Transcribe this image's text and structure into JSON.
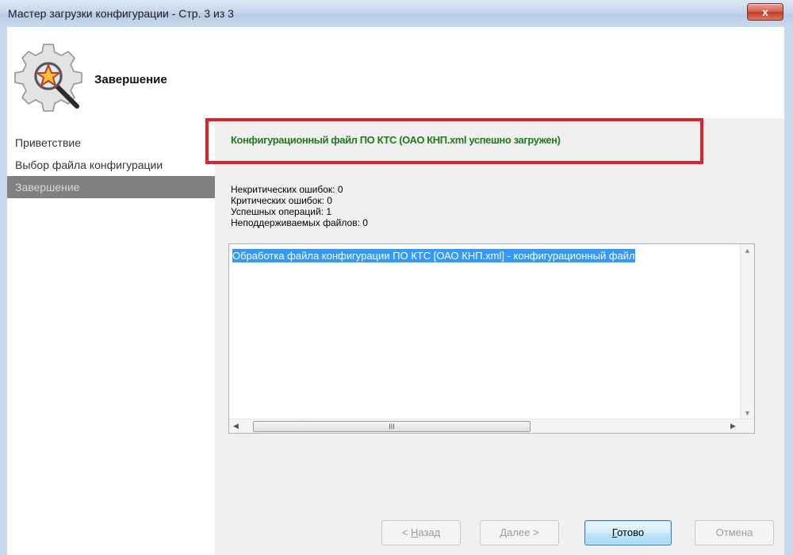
{
  "window": {
    "title": "Мастер загрузки конфигурации - Стр. 3 из 3",
    "close_label": "x"
  },
  "header": {
    "title": "Завершение",
    "logo_icon": "wizard-gear-icon"
  },
  "nav": {
    "items": [
      {
        "label": "Приветствие",
        "active": false
      },
      {
        "label": "Выбор файла конфигурации",
        "active": false
      },
      {
        "label": "Завершение",
        "active": true
      }
    ]
  },
  "result": {
    "message": "Конфигурационный файл ПО КТС (ОАО КНП.xml успешно загружен)",
    "message_color": "#1f7a17",
    "highlight_color": "#e0202a"
  },
  "stats": {
    "noncritical_errors": "Некритических ошибок: 0",
    "critical_errors": "Критических ошибок: 0",
    "successful_ops": "Успешных операций: 1",
    "unsupported_files": "Неподдерживаемых файлов: 0"
  },
  "log": {
    "lines": [
      "Обработка файла конфигурации ПО КТС [ОАО КНП.xml] - конфигурационный файл"
    ],
    "scroll_thumb_label": "III"
  },
  "buttons": {
    "back": {
      "prefix": "< ",
      "mnemonic": "Н",
      "rest": "азад"
    },
    "next": {
      "prefix": "",
      "mnemonic": "Д",
      "rest": "алее >"
    },
    "finish": {
      "prefix": "",
      "mnemonic": "Г",
      "rest": "отово"
    },
    "cancel": {
      "label": "Отмена"
    }
  }
}
